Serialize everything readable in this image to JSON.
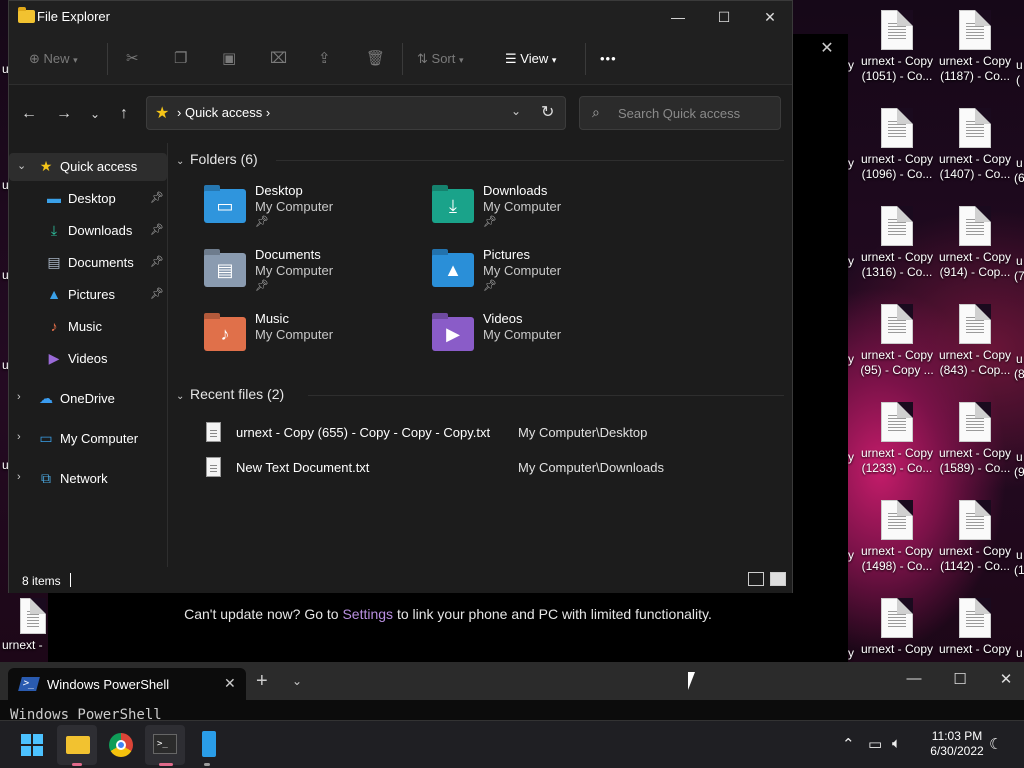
{
  "desktop": {
    "icons": [
      {
        "line1": "urnext - Copy",
        "line2": "(1051) - Co..."
      },
      {
        "line1": "urnext - Copy",
        "line2": "(1187) - Co..."
      },
      {
        "line1": "urnext - Copy",
        "line2": "(1096) - Co..."
      },
      {
        "line1": "urnext - Copy",
        "line2": "(1407) - Co..."
      },
      {
        "line1": "urnext - Copy",
        "line2": "(1316) - Co..."
      },
      {
        "line1": "urnext - Copy",
        "line2": "(914) - Cop..."
      },
      {
        "line1": "urnext - Copy",
        "line2": "(95) - Copy ..."
      },
      {
        "line1": "urnext - Copy",
        "line2": "(843) - Cop..."
      },
      {
        "line1": "urnext - Copy",
        "line2": "(1233) - Co..."
      },
      {
        "line1": "urnext - Copy",
        "line2": "(1589) - Co..."
      },
      {
        "line1": "urnext - Copy",
        "line2": "(1498) - Co..."
      },
      {
        "line1": "urnext - Copy",
        "line2": "(1142) - Co..."
      },
      {
        "line1": "urnext - Copy",
        "line2": ""
      },
      {
        "line1": "urnext - Copy",
        "line2": ""
      }
    ],
    "left_partial_label": "urnext -",
    "edge_fragments_left": [
      "y",
      "y",
      "y",
      "y",
      "y",
      "y",
      "y"
    ],
    "edge_fragments_right": [
      "u",
      "u",
      "u",
      "u",
      "u",
      "u",
      "u"
    ],
    "edge_fragments_right2": [
      "(",
      "(6",
      "(7",
      "(8",
      "(9",
      "(1"
    ],
    "left_edge_chars": [
      "u",
      "u",
      "u",
      "u",
      "u"
    ]
  },
  "background_window": {
    "close_glyph": "✕",
    "message_before": "Can't update now? Go to ",
    "message_link": "Settings",
    "message_after": " to link your phone and PC with limited functionality."
  },
  "explorer": {
    "title": "File Explorer",
    "window_buttons": {
      "minimize": "—",
      "maximize": "☐",
      "close": "✕"
    },
    "toolbar": {
      "new_label": "New",
      "sort_label": "Sort",
      "view_label": "View",
      "more_label": "•••"
    },
    "address": {
      "crumb": "Quick access"
    },
    "search": {
      "placeholder": "Search Quick access"
    },
    "sidebar": {
      "items": [
        {
          "label": "Quick access"
        },
        {
          "label": "Desktop"
        },
        {
          "label": "Downloads"
        },
        {
          "label": "Documents"
        },
        {
          "label": "Pictures"
        },
        {
          "label": "Music"
        },
        {
          "label": "Videos"
        },
        {
          "label": "OneDrive"
        },
        {
          "label": "My Computer"
        },
        {
          "label": "Network"
        }
      ]
    },
    "folders_header": "Folders (6)",
    "folders": [
      {
        "name": "Desktop",
        "location": "My Computer",
        "color": "#2f95dd"
      },
      {
        "name": "Downloads",
        "location": "My Computer",
        "color": "#1aa38a"
      },
      {
        "name": "Documents",
        "location": "My Computer",
        "color": "#8a9bb0"
      },
      {
        "name": "Pictures",
        "location": "My Computer",
        "color": "#2a8fd8"
      },
      {
        "name": "Music",
        "location": "My Computer",
        "color": "#e0704a"
      },
      {
        "name": "Videos",
        "location": "My Computer",
        "color": "#8a5cc8"
      }
    ],
    "recent_header": "Recent files (2)",
    "recent": [
      {
        "name": "urnext - Copy (655) - Copy - Copy - Copy.txt",
        "location": "My Computer\\Desktop"
      },
      {
        "name": "New Text Document.txt",
        "location": "My Computer\\Downloads"
      }
    ],
    "status": {
      "items": "8 items"
    }
  },
  "terminal": {
    "tab_title": "Windows PowerShell",
    "output": "Windows PowerShell",
    "window_buttons": {
      "minimize": "—",
      "maximize": "☐",
      "close": "✕"
    }
  },
  "taskbar": {
    "time": "11:03 PM",
    "date": "6/30/2022"
  },
  "colors": {
    "accent": "#4cc2ff",
    "link": "#b98fe0"
  }
}
